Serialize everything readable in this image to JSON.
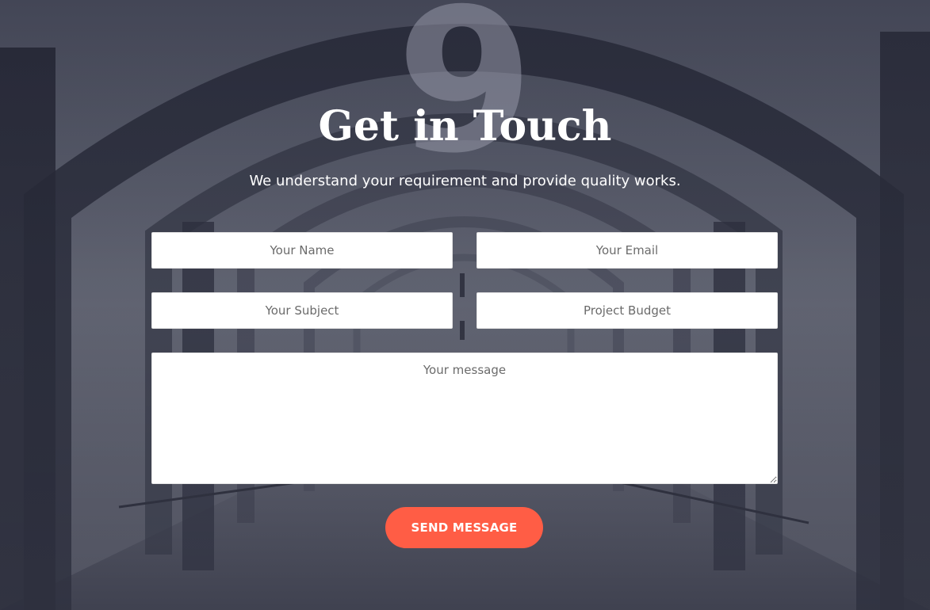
{
  "section": {
    "background_number": "9",
    "title": "Get in Touch",
    "subtitle": "We understand your requirement and provide quality works."
  },
  "form": {
    "name_placeholder": "Your Name",
    "email_placeholder": "Your Email",
    "subject_placeholder": "Your Subject",
    "budget_placeholder": "Project Budget",
    "message_placeholder": "Your message",
    "send_label": "SEND MESSAGE"
  },
  "colors": {
    "accent": "#ff5d45",
    "overlay": "#1f2030",
    "title_text": "#ffffff"
  }
}
